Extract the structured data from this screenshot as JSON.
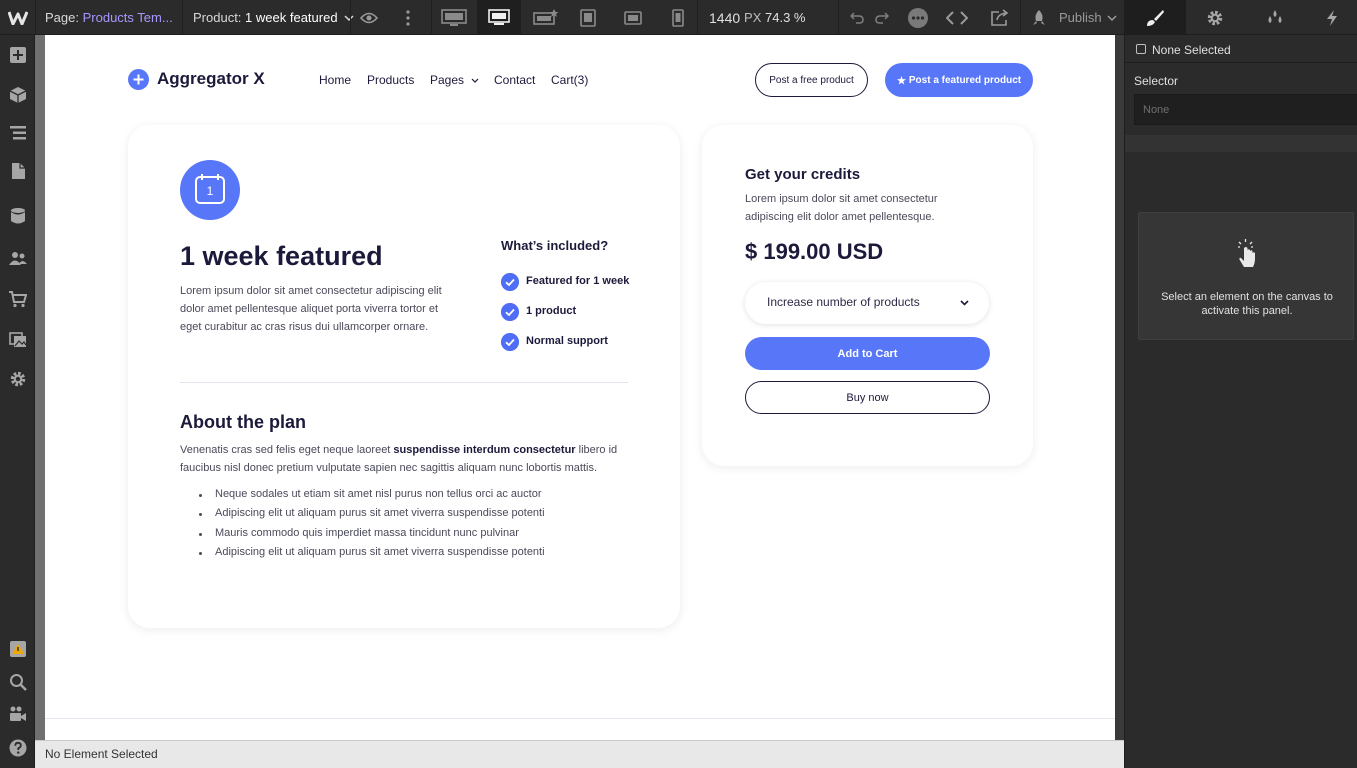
{
  "toolbar": {
    "page_label": "Page:",
    "page_name": "Products Tem...",
    "product_label": "Product:",
    "product_name": "1 week featured",
    "width_value": "1440",
    "width_unit": "PX",
    "zoom": "74.3 %",
    "publish_label": "Publish"
  },
  "site": {
    "brand": "Aggregator X",
    "nav": [
      "Home",
      "Products",
      "Pages",
      "Contact",
      "Cart(3)"
    ],
    "btn_free": "Post a free product",
    "btn_featured": "Post a featured product",
    "icon_day": "1",
    "title": "1 week featured",
    "desc": "Lorem ipsum dolor sit amet consectetur adipiscing elit dolor amet pellentesque aliquet porta viverra tortor et eget curabitur ac cras risus dui ullamcorper ornare.",
    "included_heading": "What’s included?",
    "included": [
      "Featured for 1 week",
      "1 product",
      "Normal support"
    ],
    "about_heading": "About the plan",
    "about_text_1": "Venenatis cras sed felis eget neque laoreet ",
    "about_text_bold": "suspendisse interdum consectetur",
    "about_text_2": " libero id faucibus nisl donec pretium vulputate sapien nec sagittis aliquam nunc lobortis mattis.",
    "bullets": [
      "Neque sodales ut etiam sit amet nisl purus non tellus orci ac auctor",
      "Adipiscing elit ut aliquam purus sit amet viverra suspendisse potenti",
      "Mauris commodo quis imperdiet massa tincidunt nunc pulvinar",
      "Adipiscing elit ut aliquam purus sit amet viverra suspendisse potenti"
    ],
    "credits_heading": "Get your credits",
    "credits_text": "Lorem ipsum dolor sit amet consectetur adipiscing elit dolor amet pellentesque.",
    "price": "$ 199.00 USD",
    "select_value": "Increase number of products",
    "add_to_cart": "Add to Cart",
    "buy_now": "Buy now"
  },
  "status_bar": "No Element Selected",
  "right_panel": {
    "none_selected": "None Selected",
    "selector_label": "Selector",
    "selector_placeholder": "None",
    "hint": "Select an element on the canvas to activate this panel."
  },
  "colors": {
    "accent": "#5777f8",
    "dark_text": "#1c1a3b",
    "chrome_bg": "#2b2b2b"
  }
}
